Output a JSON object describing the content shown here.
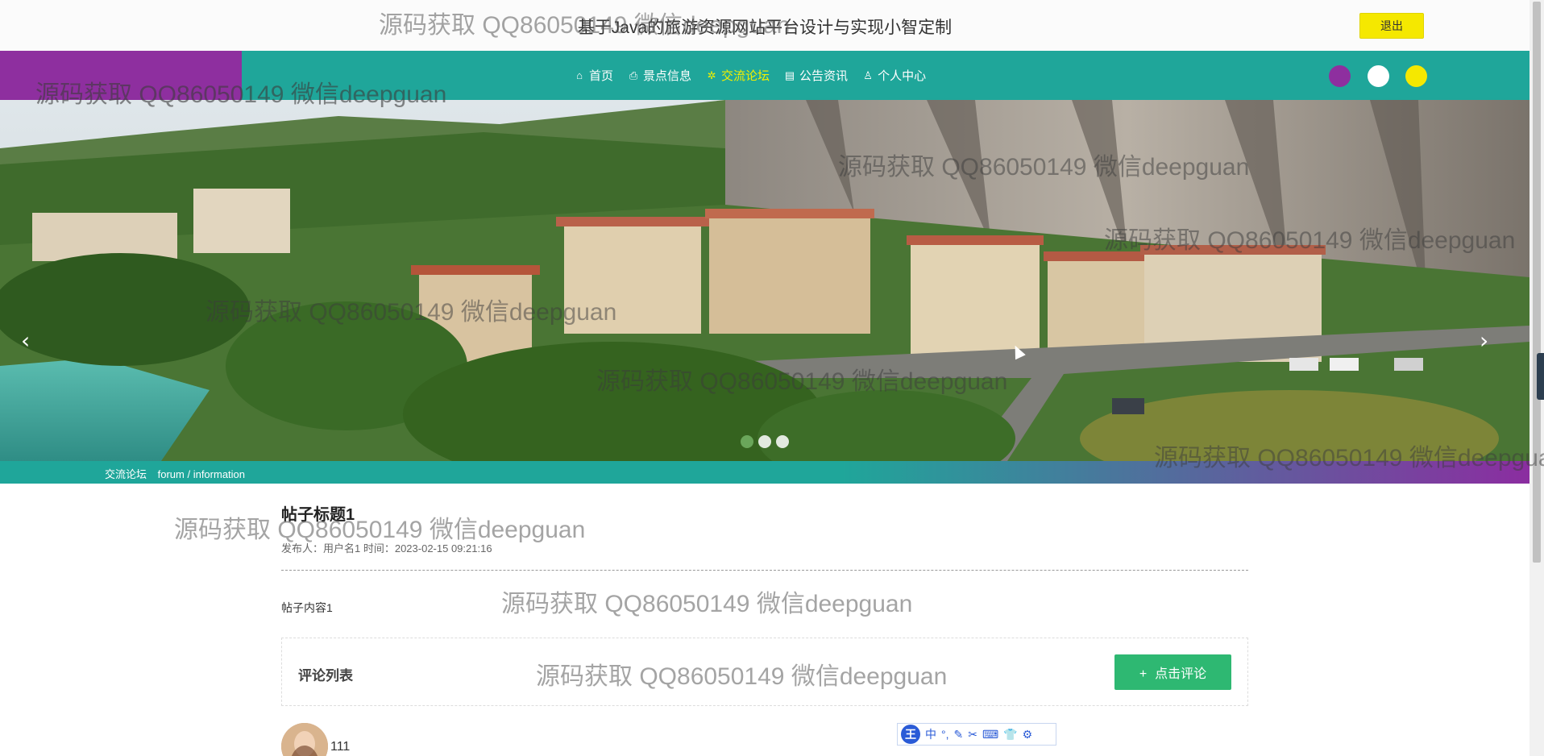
{
  "header": {
    "title": "基于Java的旅游资源网站平台设计与实现小智定制",
    "logout_label": "退出"
  },
  "nav": {
    "items": [
      {
        "label": "首页",
        "icon": "home-icon"
      },
      {
        "label": "景点信息",
        "icon": "printer-icon"
      },
      {
        "label": "交流论坛",
        "icon": "forum-icon",
        "active": true
      },
      {
        "label": "公告资讯",
        "icon": "notice-icon"
      },
      {
        "label": "个人中心",
        "icon": "user-icon"
      }
    ],
    "theme_colors": [
      "#8e2f9f",
      "#ffffff",
      "#f5e800"
    ]
  },
  "carousel": {
    "prev_icon": "‹",
    "next_icon": "›",
    "slide_count": 3,
    "active_slide": 0
  },
  "breadcrumb": {
    "title": "交流论坛",
    "path": "forum / information"
  },
  "post": {
    "title": "帖子标题1",
    "meta": "发布人：用户名1 时间：2023-02-15 09:21:16",
    "content": "帖子内容1"
  },
  "comments": {
    "section_label": "评论列表",
    "add_button_label": "点击评论",
    "add_button_icon": "+",
    "first_user": "111"
  },
  "ime": {
    "logo": "王",
    "items": [
      "中",
      "°,",
      "✎",
      "✂",
      "⌨",
      "👕",
      "⚙"
    ]
  },
  "watermark": "源码获取 QQ86050149 微信deepguan",
  "colors": {
    "nav_bg": "#1fa69a",
    "accent_purple": "#8e2f9f",
    "active_nav": "#f3f000",
    "comment_button": "#2eb872",
    "logout_bg": "#f5e800"
  }
}
